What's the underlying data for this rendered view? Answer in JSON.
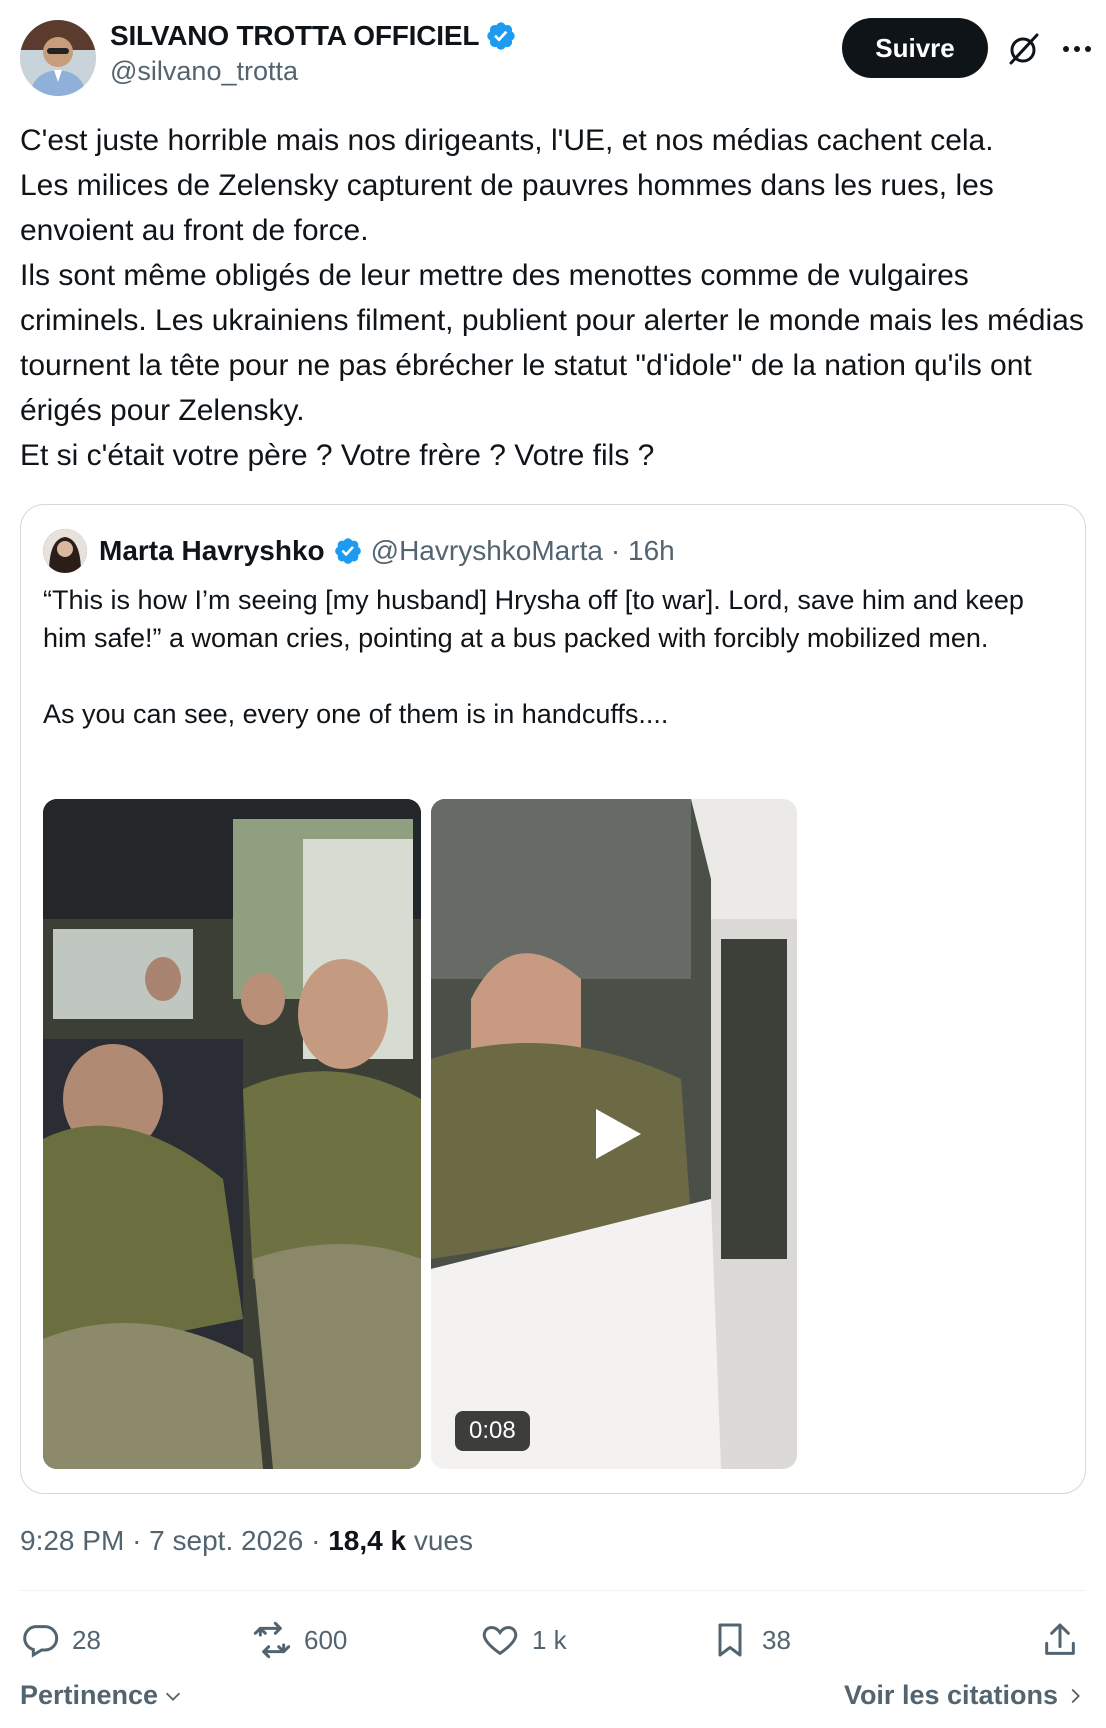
{
  "author": {
    "display_name": "SILVANO TROTTA OFFICIEL",
    "handle": "@silvano_trotta",
    "verified": true,
    "follow_label": "Suivre"
  },
  "tweet": {
    "text": "C'est juste horrible mais nos dirigeants, l'UE, et nos médias cachent cela.\nLes milices de Zelensky capturent de pauvres hommes dans les rues, les envoient au front de force.\nIls sont même obligés de leur mettre des menottes comme de vulgaires criminels. Les ukrainiens filment, publient pour alerter le monde mais les médias tournent la tête pour ne pas ébrécher le statut \"d'idole\" de la nation qu'ils ont érigés pour Zelensky.\nEt si c'était votre père ? Votre frère ? Votre fils ?"
  },
  "quoted": {
    "display_name": "Marta Havryshko",
    "handle": "@HavryshkoMarta",
    "time": "· 16h",
    "text": "“This is how I’m seeing [my husband] Hrysha off [to war]. Lord, save him and keep him safe!” a woman cries, pointing at a bus packed with forcibly mobilized men.\n\nAs you can see, every one of them is in handcuffs....",
    "video_duration": "0:08"
  },
  "meta": {
    "time": "9:28 PM",
    "date": "7 sept. 2026",
    "views_count": "18,4 k",
    "views_label": "vues"
  },
  "actions": {
    "replies": "28",
    "reposts": "600",
    "likes": "1 k",
    "bookmarks": "38"
  },
  "footer": {
    "sort_label": "Pertinence",
    "quotes_label": "Voir les citations"
  },
  "colors": {
    "text_primary": "#0f1419",
    "text_secondary": "#536471",
    "verified_blue": "#1d9bf0",
    "border": "#cfd9de"
  }
}
